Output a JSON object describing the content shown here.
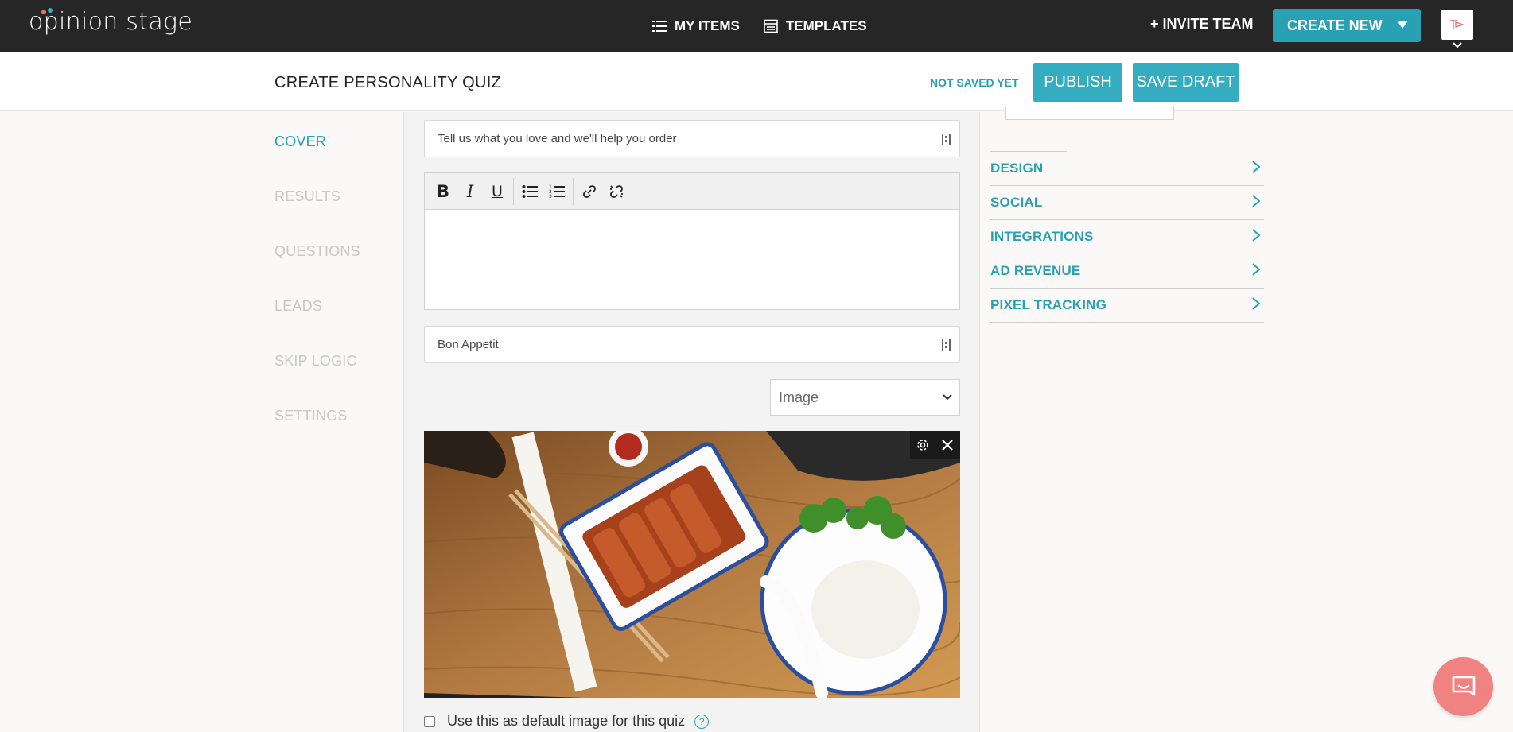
{
  "brand": {
    "name": "opinion stage",
    "accent": "#29a1b5"
  },
  "topnav": {
    "my_items": "MY ITEMS",
    "templates": "TEMPLATES",
    "invite": "+ INVITE TEAM",
    "create_new": "CREATE NEW"
  },
  "header": {
    "title": "CREATE PERSONALITY QUIZ",
    "status": "NOT SAVED YET",
    "publish": "PUBLISH",
    "save_draft": "SAVE DRAFT"
  },
  "sidebar": {
    "items": [
      {
        "label": "COVER",
        "active": true
      },
      {
        "label": "RESULTS",
        "active": false
      },
      {
        "label": "QUESTIONS",
        "active": false
      },
      {
        "label": "LEADS",
        "active": false
      },
      {
        "label": "SKIP LOGIC",
        "active": false
      },
      {
        "label": "SETTINGS",
        "active": false
      }
    ]
  },
  "cover": {
    "subtitle_value": "Tell us what you love and we'll help you order",
    "button_value": "Bon Appetit",
    "media_type": "Image",
    "default_image_label": "Use this as default image for this quiz",
    "help": "?"
  },
  "editor_toolbar": [
    "bold-icon",
    "italic-icon",
    "underline-icon",
    "bullet-list-icon",
    "numbered-list-icon",
    "link-icon",
    "unlink-icon"
  ],
  "settings_panel": {
    "items": [
      "DESIGN",
      "SOCIAL",
      "INTEGRATIONS",
      "AD REVENUE",
      "PIXEL TRACKING"
    ]
  }
}
